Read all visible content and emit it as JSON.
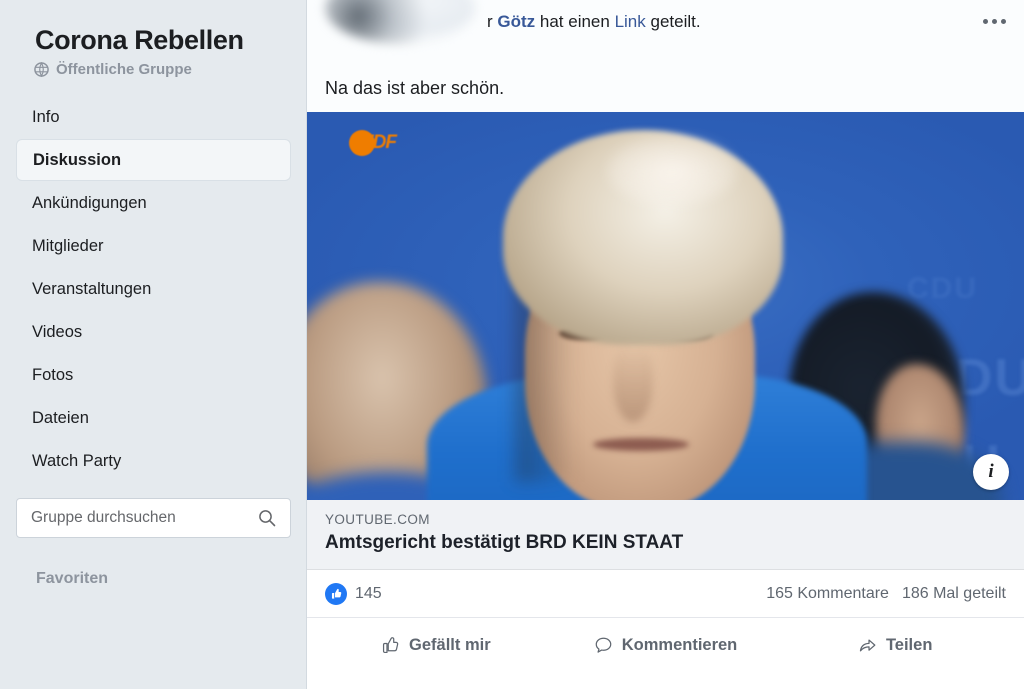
{
  "sidebar": {
    "group_title": "Corona Rebellen",
    "privacy_label": "Öffentliche Gruppe",
    "privacy_icon": "globe-icon",
    "nav_items": [
      {
        "label": "Info",
        "active": false
      },
      {
        "label": "Diskussion",
        "active": true
      },
      {
        "label": "Ankündigungen",
        "active": false
      },
      {
        "label": "Mitglieder",
        "active": false
      },
      {
        "label": "Veranstaltungen",
        "active": false
      },
      {
        "label": "Videos",
        "active": false
      },
      {
        "label": "Fotos",
        "active": false
      },
      {
        "label": "Dateien",
        "active": false
      },
      {
        "label": "Watch Party",
        "active": false
      }
    ],
    "search": {
      "placeholder": "Gruppe durchsuchen",
      "value": "",
      "icon": "search-icon"
    },
    "section_label": "Favoriten"
  },
  "post": {
    "byline_prefix": "r ",
    "author_name": "Götz",
    "byline_middle": " hat einen ",
    "byline_link_word": "Link",
    "byline_suffix": " geteilt.",
    "more_icon": "ellipsis-icon",
    "body_text": "Na das ist aber schön.",
    "thumbnail": {
      "channel_logo": "zdf-logo",
      "channel_logo_text": "ZDF",
      "backdrop_text": "CDU",
      "info_icon": "info-icon",
      "info_glyph": "i"
    },
    "link_preview": {
      "domain": "YOUTUBE.COM",
      "title": "Amtsgericht bestätigt BRD KEIN STAAT"
    },
    "stats": {
      "reaction_icon": "thumbs-up-filled-icon",
      "reaction_count": "145",
      "comments": "165 Kommentare",
      "shares": "186 Mal geteilt"
    },
    "actions": [
      {
        "label": "Gefällt mir",
        "icon": "thumbs-up-outline-icon"
      },
      {
        "label": "Kommentieren",
        "icon": "comment-bubble-icon"
      },
      {
        "label": "Teilen",
        "icon": "share-arrow-icon"
      }
    ]
  },
  "colors": {
    "sidebar_bg": "#e5eaee",
    "accent_blue": "#385898",
    "like_blue": "#2078f4",
    "link_preview_bg": "#f0f2f5",
    "text_primary": "#1c1e21",
    "text_secondary": "#606770",
    "zdf_orange": "#ef7d00"
  }
}
